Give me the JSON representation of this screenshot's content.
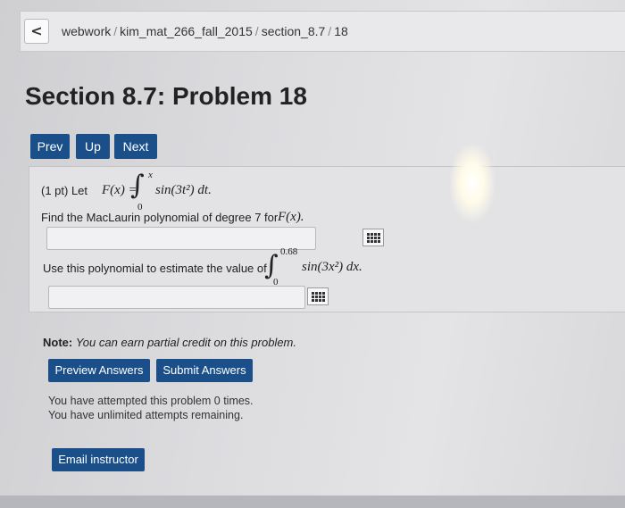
{
  "breadcrumb": {
    "back_symbol": "<",
    "parts": [
      "webwork",
      "kim_mat_266_fall_2015",
      "section_8.7",
      "18"
    ],
    "separator": "/"
  },
  "page_title": "Section 8.7: Problem 18",
  "nav": {
    "prev": "Prev",
    "up": "Up",
    "next": "Next"
  },
  "problem": {
    "points": "(1 pt) Let",
    "def_lhs": "F(x) =",
    "integral_symbol": "∫",
    "integral1_upper": "x",
    "integral1_lower": "0",
    "integrand1": "sin(3t²) dt.",
    "part1_text": "Find the MacLaurin polynomial of degree 7 for",
    "part1_func": "F(x).",
    "part2_text": "Use this polynomial to estimate the value of",
    "integral2_upper": "0.68",
    "integral2_lower": "0",
    "integrand2": "sin(3x²) dx."
  },
  "answers": [
    {
      "value": "",
      "icon": "grid-icon"
    },
    {
      "value": "",
      "icon": "grid-icon"
    }
  ],
  "note": {
    "label": "Note:",
    "text": "You can earn partial credit on this problem."
  },
  "actions": {
    "preview": "Preview Answers",
    "submit": "Submit Answers"
  },
  "attempts": {
    "line1": "You have attempted this problem 0 times.",
    "line2": "You have unlimited attempts remaining."
  },
  "email_button": "Email instructor",
  "colors": {
    "button_bg": "#1a4f8a",
    "button_text": "#ffffff"
  }
}
